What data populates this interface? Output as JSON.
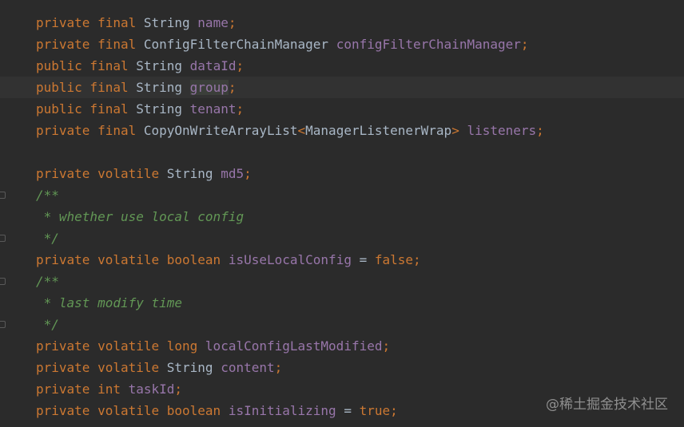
{
  "editor": {
    "lines": [
      {
        "tokens": [
          {
            "t": "private final ",
            "c": "kw"
          },
          {
            "t": "String ",
            "c": "type"
          },
          {
            "t": "name",
            "c": "field"
          },
          {
            "t": ";",
            "c": "punc"
          }
        ]
      },
      {
        "tokens": [
          {
            "t": "private final ",
            "c": "kw"
          },
          {
            "t": "ConfigFilterChainManager ",
            "c": "type"
          },
          {
            "t": "configFilterChainManager",
            "c": "field"
          },
          {
            "t": ";",
            "c": "punc"
          }
        ]
      },
      {
        "tokens": [
          {
            "t": "public final ",
            "c": "kw"
          },
          {
            "t": "String ",
            "c": "type"
          },
          {
            "t": "dataId",
            "c": "field"
          },
          {
            "t": ";",
            "c": "punc"
          }
        ]
      },
      {
        "tokens": [
          {
            "t": "public final ",
            "c": "kw"
          },
          {
            "t": "String ",
            "c": "type"
          },
          {
            "t": "group",
            "c": "field hl"
          },
          {
            "t": ";",
            "c": "punc"
          }
        ],
        "current": true
      },
      {
        "tokens": [
          {
            "t": "public final ",
            "c": "kw"
          },
          {
            "t": "String ",
            "c": "type"
          },
          {
            "t": "tenant",
            "c": "field"
          },
          {
            "t": ";",
            "c": "punc"
          }
        ]
      },
      {
        "tokens": [
          {
            "t": "private final ",
            "c": "kw"
          },
          {
            "t": "CopyOnWriteArrayList",
            "c": "type"
          },
          {
            "t": "<",
            "c": "kw"
          },
          {
            "t": "ManagerListenerWrap",
            "c": "type"
          },
          {
            "t": "> ",
            "c": "kw"
          },
          {
            "t": "listeners",
            "c": "field"
          },
          {
            "t": ";",
            "c": "punc"
          }
        ]
      },
      {
        "tokens": []
      },
      {
        "tokens": [
          {
            "t": "private volatile ",
            "c": "kw"
          },
          {
            "t": "String ",
            "c": "type"
          },
          {
            "t": "md5",
            "c": "field"
          },
          {
            "t": ";",
            "c": "punc"
          }
        ]
      },
      {
        "tokens": [
          {
            "t": "/**",
            "c": "doc"
          }
        ],
        "fold": true
      },
      {
        "tokens": [
          {
            "t": " * whether use local config",
            "c": "doc"
          }
        ]
      },
      {
        "tokens": [
          {
            "t": " */",
            "c": "doc"
          }
        ],
        "fold": true
      },
      {
        "tokens": [
          {
            "t": "private volatile boolean ",
            "c": "kw"
          },
          {
            "t": "isUseLocalConfig ",
            "c": "field"
          },
          {
            "t": "= ",
            "c": "op"
          },
          {
            "t": "false",
            "c": "kw"
          },
          {
            "t": ";",
            "c": "punc"
          }
        ]
      },
      {
        "tokens": [
          {
            "t": "/**",
            "c": "doc"
          }
        ],
        "fold": true
      },
      {
        "tokens": [
          {
            "t": " * last modify time",
            "c": "doc"
          }
        ]
      },
      {
        "tokens": [
          {
            "t": " */",
            "c": "doc"
          }
        ],
        "fold": true
      },
      {
        "tokens": [
          {
            "t": "private volatile long ",
            "c": "kw"
          },
          {
            "t": "localConfigLastModified",
            "c": "field"
          },
          {
            "t": ";",
            "c": "punc"
          }
        ]
      },
      {
        "tokens": [
          {
            "t": "private volatile ",
            "c": "kw"
          },
          {
            "t": "String ",
            "c": "type"
          },
          {
            "t": "content",
            "c": "field"
          },
          {
            "t": ";",
            "c": "punc"
          }
        ]
      },
      {
        "tokens": [
          {
            "t": "private int ",
            "c": "kw"
          },
          {
            "t": "taskId",
            "c": "field"
          },
          {
            "t": ";",
            "c": "punc"
          }
        ]
      },
      {
        "tokens": [
          {
            "t": "private volatile boolean ",
            "c": "kw"
          },
          {
            "t": "isInitializing ",
            "c": "field"
          },
          {
            "t": "= ",
            "c": "op"
          },
          {
            "t": "true",
            "c": "kw"
          },
          {
            "t": ";",
            "c": "punc"
          }
        ]
      }
    ]
  },
  "watermark": "@稀土掘金技术社区",
  "colors": {
    "background": "#2b2b2b",
    "keyword": "#cc7832",
    "field": "#9876aa",
    "type": "#a9b7c6",
    "doc_comment": "#629755",
    "current_line": "#323232"
  }
}
